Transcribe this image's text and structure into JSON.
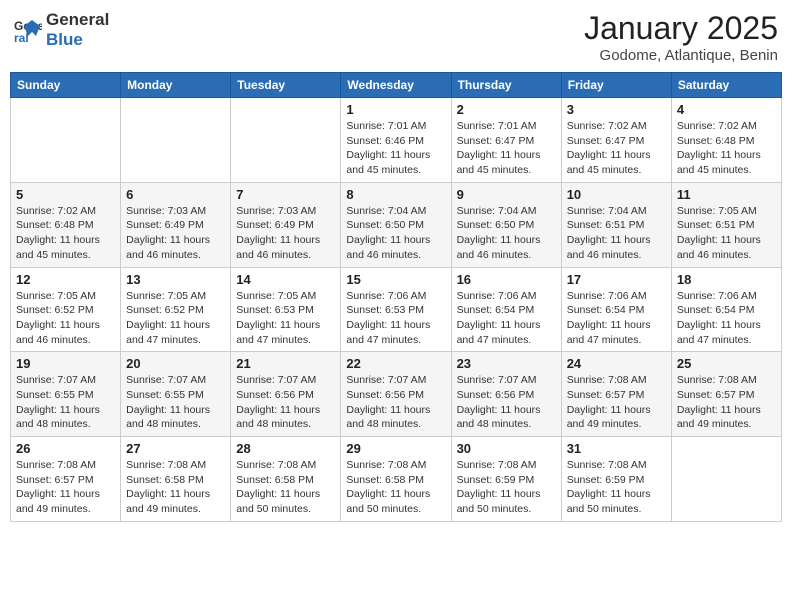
{
  "header": {
    "logo_general": "General",
    "logo_blue": "Blue",
    "month": "January 2025",
    "location": "Godome, Atlantique, Benin"
  },
  "weekdays": [
    "Sunday",
    "Monday",
    "Tuesday",
    "Wednesday",
    "Thursday",
    "Friday",
    "Saturday"
  ],
  "weeks": [
    [
      {
        "day": "",
        "info": ""
      },
      {
        "day": "",
        "info": ""
      },
      {
        "day": "",
        "info": ""
      },
      {
        "day": "1",
        "info": "Sunrise: 7:01 AM\nSunset: 6:46 PM\nDaylight: 11 hours\nand 45 minutes."
      },
      {
        "day": "2",
        "info": "Sunrise: 7:01 AM\nSunset: 6:47 PM\nDaylight: 11 hours\nand 45 minutes."
      },
      {
        "day": "3",
        "info": "Sunrise: 7:02 AM\nSunset: 6:47 PM\nDaylight: 11 hours\nand 45 minutes."
      },
      {
        "day": "4",
        "info": "Sunrise: 7:02 AM\nSunset: 6:48 PM\nDaylight: 11 hours\nand 45 minutes."
      }
    ],
    [
      {
        "day": "5",
        "info": "Sunrise: 7:02 AM\nSunset: 6:48 PM\nDaylight: 11 hours\nand 45 minutes."
      },
      {
        "day": "6",
        "info": "Sunrise: 7:03 AM\nSunset: 6:49 PM\nDaylight: 11 hours\nand 46 minutes."
      },
      {
        "day": "7",
        "info": "Sunrise: 7:03 AM\nSunset: 6:49 PM\nDaylight: 11 hours\nand 46 minutes."
      },
      {
        "day": "8",
        "info": "Sunrise: 7:04 AM\nSunset: 6:50 PM\nDaylight: 11 hours\nand 46 minutes."
      },
      {
        "day": "9",
        "info": "Sunrise: 7:04 AM\nSunset: 6:50 PM\nDaylight: 11 hours\nand 46 minutes."
      },
      {
        "day": "10",
        "info": "Sunrise: 7:04 AM\nSunset: 6:51 PM\nDaylight: 11 hours\nand 46 minutes."
      },
      {
        "day": "11",
        "info": "Sunrise: 7:05 AM\nSunset: 6:51 PM\nDaylight: 11 hours\nand 46 minutes."
      }
    ],
    [
      {
        "day": "12",
        "info": "Sunrise: 7:05 AM\nSunset: 6:52 PM\nDaylight: 11 hours\nand 46 minutes."
      },
      {
        "day": "13",
        "info": "Sunrise: 7:05 AM\nSunset: 6:52 PM\nDaylight: 11 hours\nand 47 minutes."
      },
      {
        "day": "14",
        "info": "Sunrise: 7:05 AM\nSunset: 6:53 PM\nDaylight: 11 hours\nand 47 minutes."
      },
      {
        "day": "15",
        "info": "Sunrise: 7:06 AM\nSunset: 6:53 PM\nDaylight: 11 hours\nand 47 minutes."
      },
      {
        "day": "16",
        "info": "Sunrise: 7:06 AM\nSunset: 6:54 PM\nDaylight: 11 hours\nand 47 minutes."
      },
      {
        "day": "17",
        "info": "Sunrise: 7:06 AM\nSunset: 6:54 PM\nDaylight: 11 hours\nand 47 minutes."
      },
      {
        "day": "18",
        "info": "Sunrise: 7:06 AM\nSunset: 6:54 PM\nDaylight: 11 hours\nand 47 minutes."
      }
    ],
    [
      {
        "day": "19",
        "info": "Sunrise: 7:07 AM\nSunset: 6:55 PM\nDaylight: 11 hours\nand 48 minutes."
      },
      {
        "day": "20",
        "info": "Sunrise: 7:07 AM\nSunset: 6:55 PM\nDaylight: 11 hours\nand 48 minutes."
      },
      {
        "day": "21",
        "info": "Sunrise: 7:07 AM\nSunset: 6:56 PM\nDaylight: 11 hours\nand 48 minutes."
      },
      {
        "day": "22",
        "info": "Sunrise: 7:07 AM\nSunset: 6:56 PM\nDaylight: 11 hours\nand 48 minutes."
      },
      {
        "day": "23",
        "info": "Sunrise: 7:07 AM\nSunset: 6:56 PM\nDaylight: 11 hours\nand 48 minutes."
      },
      {
        "day": "24",
        "info": "Sunrise: 7:08 AM\nSunset: 6:57 PM\nDaylight: 11 hours\nand 49 minutes."
      },
      {
        "day": "25",
        "info": "Sunrise: 7:08 AM\nSunset: 6:57 PM\nDaylight: 11 hours\nand 49 minutes."
      }
    ],
    [
      {
        "day": "26",
        "info": "Sunrise: 7:08 AM\nSunset: 6:57 PM\nDaylight: 11 hours\nand 49 minutes."
      },
      {
        "day": "27",
        "info": "Sunrise: 7:08 AM\nSunset: 6:58 PM\nDaylight: 11 hours\nand 49 minutes."
      },
      {
        "day": "28",
        "info": "Sunrise: 7:08 AM\nSunset: 6:58 PM\nDaylight: 11 hours\nand 50 minutes."
      },
      {
        "day": "29",
        "info": "Sunrise: 7:08 AM\nSunset: 6:58 PM\nDaylight: 11 hours\nand 50 minutes."
      },
      {
        "day": "30",
        "info": "Sunrise: 7:08 AM\nSunset: 6:59 PM\nDaylight: 11 hours\nand 50 minutes."
      },
      {
        "day": "31",
        "info": "Sunrise: 7:08 AM\nSunset: 6:59 PM\nDaylight: 11 hours\nand 50 minutes."
      },
      {
        "day": "",
        "info": ""
      }
    ]
  ]
}
